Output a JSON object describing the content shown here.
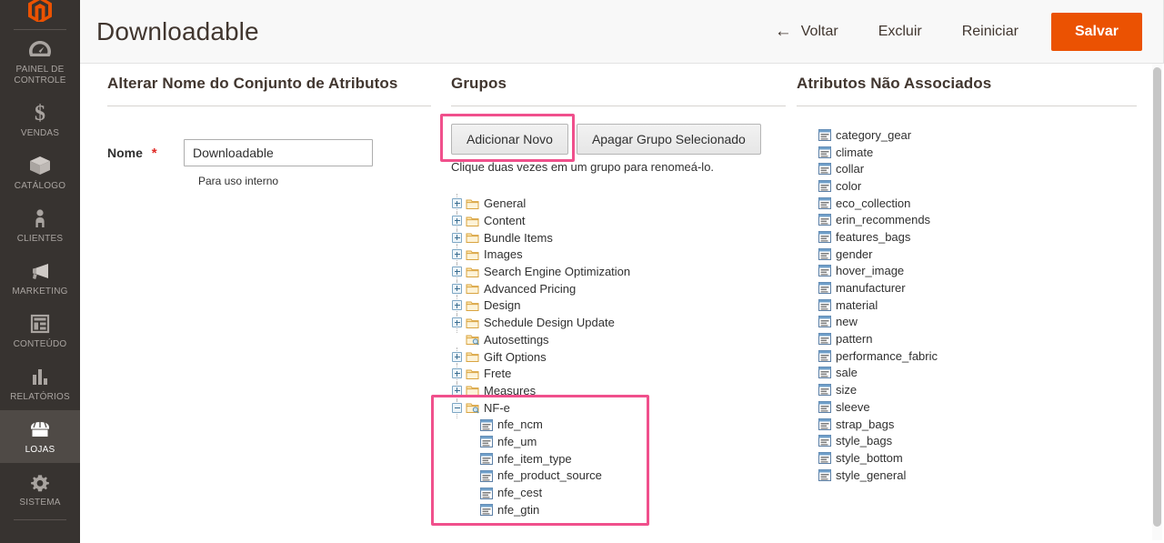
{
  "sidebar": {
    "logo_icon": "magento-logo-icon",
    "items": [
      {
        "label": "Painel de Controle",
        "icon": "dashboard-icon",
        "active": false
      },
      {
        "label": "Vendas",
        "icon": "dollar-icon",
        "active": false
      },
      {
        "label": "Catálogo",
        "icon": "box-icon",
        "active": false
      },
      {
        "label": "Clientes",
        "icon": "person-icon",
        "active": false
      },
      {
        "label": "Marketing",
        "icon": "megaphone-icon",
        "active": false
      },
      {
        "label": "Conteúdo",
        "icon": "layout-icon",
        "active": false
      },
      {
        "label": "Relatórios",
        "icon": "bar-chart-icon",
        "active": false
      },
      {
        "label": "Lojas",
        "icon": "storefront-icon",
        "active": true
      },
      {
        "label": "Sistema",
        "icon": "gear-icon",
        "active": false
      }
    ]
  },
  "header": {
    "title": "Downloadable",
    "back_label": "Voltar",
    "back_icon": "arrow-left-icon",
    "delete_label": "Excluir",
    "reset_label": "Reiniciar",
    "save_label": "Salvar",
    "save_color": "#eb5202"
  },
  "left_panel": {
    "title": "Alterar Nome do Conjunto de Atributos",
    "name_label": "Nome",
    "required_marker": "*",
    "name_value": "Downloadable",
    "name_placeholder": "",
    "note": "Para uso interno"
  },
  "groups_panel": {
    "title": "Grupos",
    "add_new_label": "Adicionar Novo",
    "delete_group_label": "Apagar Grupo Selecionado",
    "hint": "Clique duas vezes em um grupo para renomeá-lo.",
    "highlight_color": "#f0508c",
    "tree": [
      {
        "label": "General",
        "icon": "folder-icon",
        "expandable": true,
        "expanded": false
      },
      {
        "label": "Content",
        "icon": "folder-icon",
        "expandable": true,
        "expanded": false
      },
      {
        "label": "Bundle Items",
        "icon": "folder-icon",
        "expandable": true,
        "expanded": false
      },
      {
        "label": "Images",
        "icon": "folder-icon",
        "expandable": true,
        "expanded": false
      },
      {
        "label": "Search Engine Optimization",
        "icon": "folder-icon",
        "expandable": true,
        "expanded": false
      },
      {
        "label": "Advanced Pricing",
        "icon": "folder-icon",
        "expandable": true,
        "expanded": false
      },
      {
        "label": "Design",
        "icon": "folder-icon",
        "expandable": true,
        "expanded": false
      },
      {
        "label": "Schedule Design Update",
        "icon": "folder-icon",
        "expandable": true,
        "expanded": false
      },
      {
        "label": "Autosettings",
        "icon": "folder-search-icon",
        "expandable": false,
        "expanded": false
      },
      {
        "label": "Gift Options",
        "icon": "folder-icon",
        "expandable": true,
        "expanded": false
      },
      {
        "label": "Frete",
        "icon": "folder-icon",
        "expandable": true,
        "expanded": false
      },
      {
        "label": "Measures",
        "icon": "folder-icon",
        "expandable": true,
        "expanded": false
      },
      {
        "label": "NF-e",
        "icon": "folder-search-icon",
        "expandable": true,
        "expanded": true
      }
    ],
    "nfe_children": [
      {
        "label": "nfe_ncm",
        "icon": "attribute-icon"
      },
      {
        "label": "nfe_um",
        "icon": "attribute-icon"
      },
      {
        "label": "nfe_item_type",
        "icon": "attribute-icon"
      },
      {
        "label": "nfe_product_source",
        "icon": "attribute-icon"
      },
      {
        "label": "nfe_cest",
        "icon": "attribute-icon"
      },
      {
        "label": "nfe_gtin",
        "icon": "attribute-icon"
      }
    ]
  },
  "unassigned_panel": {
    "title": "Atributos Não Associados",
    "attributes": [
      {
        "label": "category_gear",
        "icon": "attribute-icon"
      },
      {
        "label": "climate",
        "icon": "attribute-icon"
      },
      {
        "label": "collar",
        "icon": "attribute-icon"
      },
      {
        "label": "color",
        "icon": "attribute-icon"
      },
      {
        "label": "eco_collection",
        "icon": "attribute-icon"
      },
      {
        "label": "erin_recommends",
        "icon": "attribute-icon"
      },
      {
        "label": "features_bags",
        "icon": "attribute-icon"
      },
      {
        "label": "gender",
        "icon": "attribute-icon"
      },
      {
        "label": "hover_image",
        "icon": "attribute-icon"
      },
      {
        "label": "manufacturer",
        "icon": "attribute-icon"
      },
      {
        "label": "material",
        "icon": "attribute-icon"
      },
      {
        "label": "new",
        "icon": "attribute-icon"
      },
      {
        "label": "pattern",
        "icon": "attribute-icon"
      },
      {
        "label": "performance_fabric",
        "icon": "attribute-icon"
      },
      {
        "label": "sale",
        "icon": "attribute-icon"
      },
      {
        "label": "size",
        "icon": "attribute-icon"
      },
      {
        "label": "sleeve",
        "icon": "attribute-icon"
      },
      {
        "label": "strap_bags",
        "icon": "attribute-icon"
      },
      {
        "label": "style_bags",
        "icon": "attribute-icon"
      },
      {
        "label": "style_bottom",
        "icon": "attribute-icon"
      },
      {
        "label": "style_general",
        "icon": "attribute-icon"
      }
    ]
  }
}
